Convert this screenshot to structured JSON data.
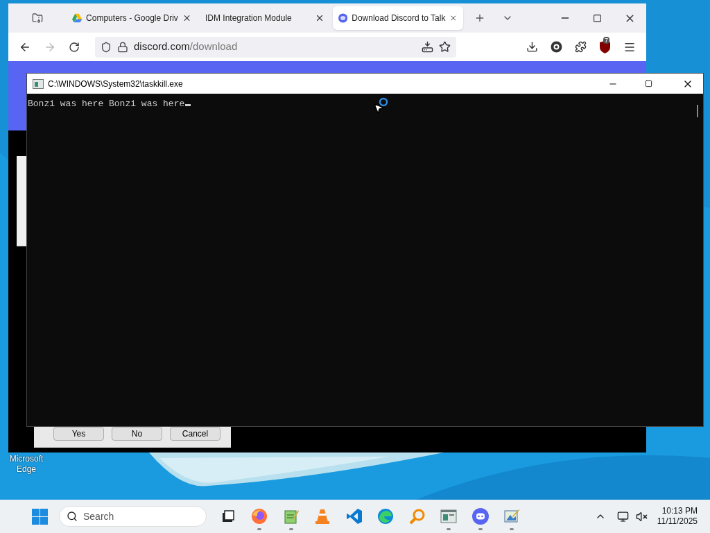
{
  "browser": {
    "tabs": [
      {
        "title": "Computers - Google Driv",
        "kind": "drive",
        "selected": false
      },
      {
        "title": "IDM Integration Module",
        "kind": "plain",
        "selected": false
      },
      {
        "title": "Download Discord to Talk",
        "kind": "discord",
        "selected": true
      }
    ],
    "url": {
      "domain": "discord.com",
      "path": "/download"
    },
    "extension_badge": "7"
  },
  "console": {
    "title": "C:\\WINDOWS\\System32\\taskkill.exe",
    "output": "Bonzi was here Bonzi was here"
  },
  "dialog": {
    "buttons": [
      "Yes",
      "No",
      "Cancel"
    ]
  },
  "desktop_icons": [
    {
      "label": "Microsoft Edge"
    }
  ],
  "taskbar": {
    "search": {
      "placeholder": "Search"
    },
    "apps": [
      {
        "kind": "taskview",
        "running": false
      },
      {
        "kind": "firefox",
        "running": true
      },
      {
        "kind": "notepad",
        "running": true
      },
      {
        "kind": "vlc",
        "running": false
      },
      {
        "kind": "vscode",
        "running": false
      },
      {
        "kind": "edge",
        "running": false
      },
      {
        "kind": "magnifier",
        "running": false
      },
      {
        "kind": "console",
        "running": true
      },
      {
        "kind": "discord",
        "running": true
      },
      {
        "kind": "paint",
        "running": true
      }
    ],
    "clock": {
      "time": "10:13 PM",
      "date": "11/11/2025"
    }
  }
}
